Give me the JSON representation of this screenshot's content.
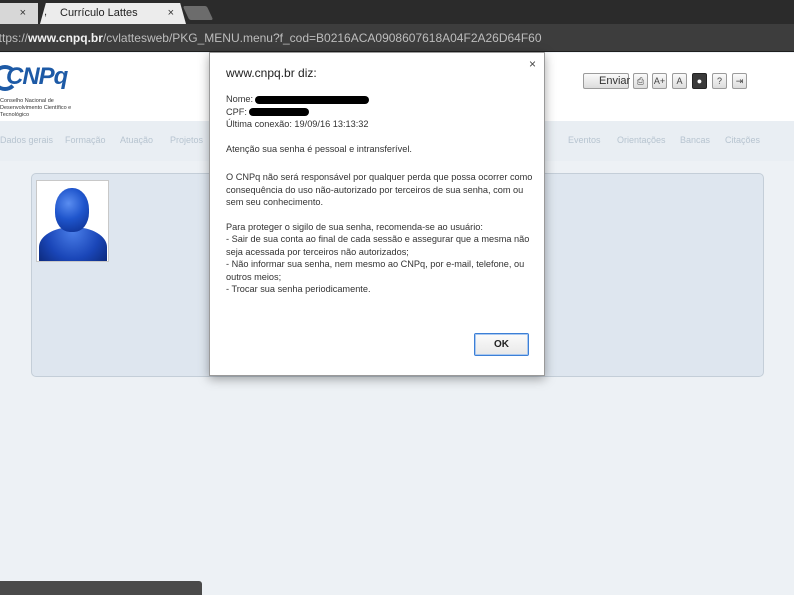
{
  "browser": {
    "tabs": [
      {
        "label": "",
        "close": "×"
      },
      {
        "label": "Currículo Lattes",
        "close": "×",
        "marker": ","
      }
    ],
    "url_prefix": "https://",
    "url_host": "www.cnpq.br",
    "url_path": "/cvlattesweb/PKG_MENU.menu?f_cod=B0216ACA0908607618A04F2A26D64F60"
  },
  "header": {
    "logo_text": "CNPq",
    "logo_subtitle": "Conselho Nacional de Desenvolvimento Científico e Tecnológico",
    "enviar_label": "Enviar",
    "tool_icons": [
      {
        "name": "print-icon",
        "glyph": "⎙"
      },
      {
        "name": "text-size-large-icon",
        "glyph": "A+"
      },
      {
        "name": "text-size-small-icon",
        "glyph": "A"
      },
      {
        "name": "contrast-icon",
        "glyph": "●"
      },
      {
        "name": "help-icon",
        "glyph": "?"
      },
      {
        "name": "exit-icon",
        "glyph": "⇥"
      }
    ]
  },
  "nav": {
    "items_left": [
      "Dados gerais",
      "Formação",
      "Atuação",
      "Projetos"
    ],
    "items_right": [
      "Eventos",
      "Orientações",
      "Bancas",
      "Citações"
    ]
  },
  "dialog": {
    "title": "www.cnpq.br diz:",
    "close": "×",
    "nome_label": "Nome:",
    "cpf_label": "CPF:",
    "ultima_conexao": "Última conexão: 19/09/16 13:13:32",
    "atencao": "Atenção sua senha é pessoal e intransferível.",
    "responsavel_1": "O CNPq não será responsável por qualquer perda que possa ocorrer como",
    "responsavel_2": "consequência do uso não-autorizado por terceiros de sua senha, com ou",
    "responsavel_3": "sem seu conhecimento.",
    "proteger": "Para proteger o sigilo de sua senha, recomenda-se ao usuário:",
    "item1_1": "- Sair de sua conta ao final de cada sessão e assegurar que a mesma não",
    "item1_2": "seja acessada por terceiros não autorizados;",
    "item2_1": "- Não informar sua senha, nem mesmo ao CNPq, por e-mail, telefone, ou",
    "item2_2": "outros meios;",
    "item3": "- Trocar sua senha periodicamente.",
    "ok_label": "OK"
  }
}
